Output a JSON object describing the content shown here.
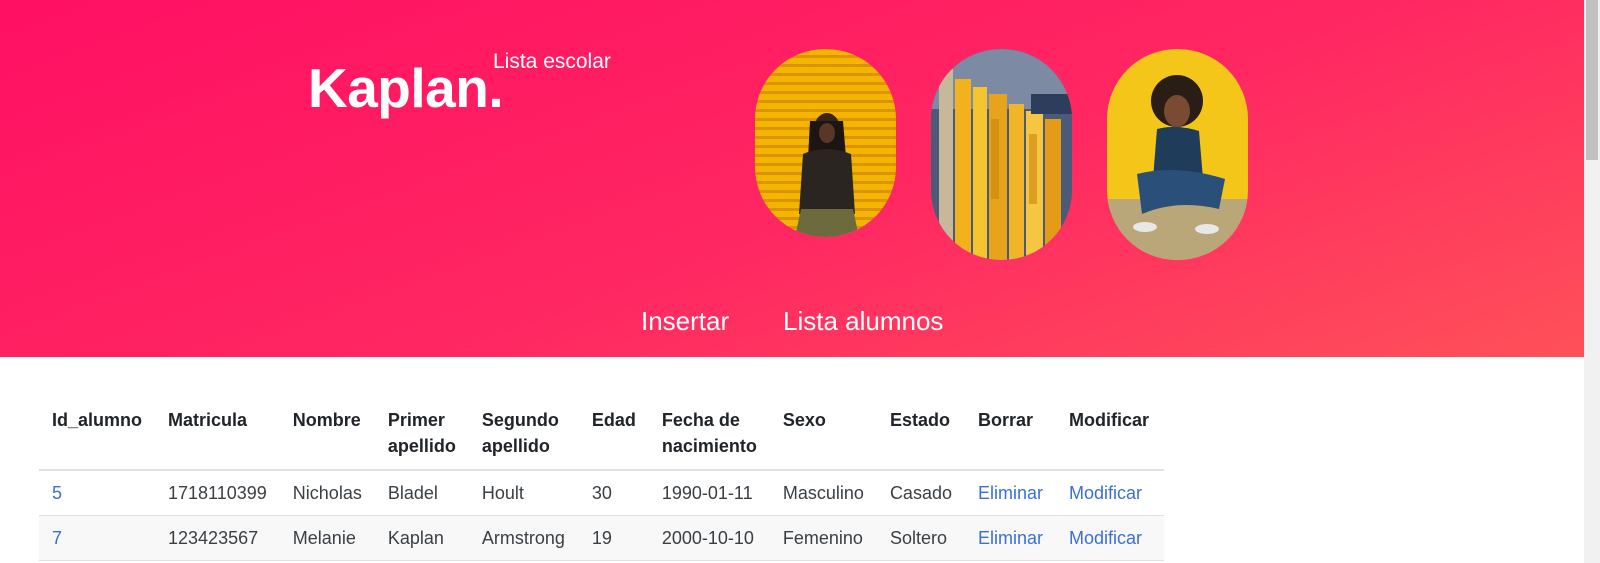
{
  "header": {
    "brand": "Kaplan.",
    "subtitle": "Lista escolar",
    "nav": [
      {
        "label": "Insertar"
      },
      {
        "label": "Lista alumnos"
      }
    ]
  },
  "colors": {
    "hero_start": "#ff0f63",
    "hero_end": "#ff5159",
    "link": "#3b6fd6"
  },
  "table": {
    "headers": {
      "id": "Id_alumno",
      "matricula": "Matricula",
      "nombre": "Nombre",
      "primer_l1": "Primer",
      "primer_l2": "apellido",
      "segundo_l1": "Segundo",
      "segundo_l2": "apellido",
      "edad": "Edad",
      "fecha_l1": "Fecha de",
      "fecha_l2": "nacimiento",
      "sexo": "Sexo",
      "estado": "Estado",
      "borrar": "Borrar",
      "modificar": "Modificar"
    },
    "rows": [
      {
        "id": "5",
        "matricula": "1718110399",
        "nombre": "Nicholas",
        "primer": "Bladel",
        "segundo": "Hoult",
        "edad": "30",
        "fecha": "1990-01-11",
        "sexo": "Masculino",
        "estado": "Casado",
        "eliminar": "Eliminar",
        "modificar": "Modificar"
      },
      {
        "id": "7",
        "matricula": "123423567",
        "nombre": "Melanie",
        "primer": "Kaplan",
        "segundo": "Armstrong",
        "edad": "19",
        "fecha": "2000-10-10",
        "sexo": "Femenino",
        "estado": "Soltero",
        "eliminar": "Eliminar",
        "modificar": "Modificar"
      }
    ]
  }
}
